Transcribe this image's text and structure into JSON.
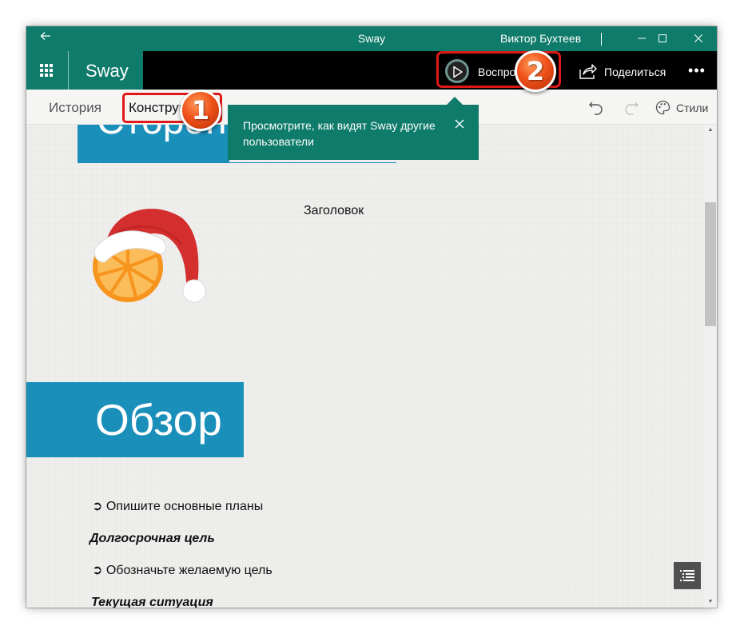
{
  "titlebar": {
    "title": "Sway",
    "user": "Виктор Бухтеев",
    "back_icon": "arrow-left-icon",
    "min_glyph": "—",
    "max_glyph": "☐",
    "close_glyph": "✕"
  },
  "appbar": {
    "app_name": "Sway",
    "play_label": "Воспроизвести",
    "share_label": "Поделиться",
    "more_glyph": "•••"
  },
  "tabs": {
    "history": "История",
    "constructor": "Конструктор",
    "styles": "Стили"
  },
  "tooltip": {
    "text": "Просмотрите, как видят Sway другие пользователи"
  },
  "canvas": {
    "top_banner_text": "Сторон",
    "heading_placeholder": "Заголовок",
    "overview_title": "Обзор",
    "bullet_1": "➲ Опишите основные планы",
    "heading_long_term": "Долгосрочная цель",
    "bullet_2": "➲ Обозначьте желаемую цель",
    "heading_current": "Текущая ситуация"
  },
  "callouts": {
    "one": "1",
    "two": "2"
  },
  "colors": {
    "accent": "#0f7b6b",
    "banner_blue": "#1a8fba",
    "highlight_red": "#e01818",
    "badge_orange": "#f0521a"
  }
}
